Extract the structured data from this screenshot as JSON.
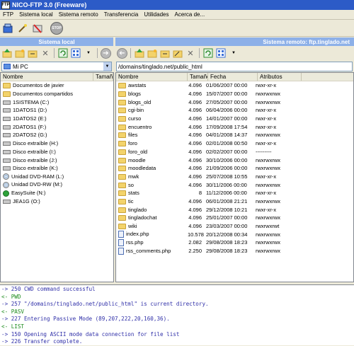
{
  "window": {
    "title": "NICO-FTP 3.0  (Freeware)",
    "app_icon": "ftp-logo-icon"
  },
  "menu": [
    "FTP",
    "Sistema local",
    "Sistema remoto",
    "Transferencia",
    "Utilidades",
    "Acerca de..."
  ],
  "main_toolbar": {
    "stop_label": "STOP"
  },
  "local": {
    "header": "Sistema local",
    "path": "Mi PC",
    "columns": {
      "name": "Nombre",
      "size": "Tamañ"
    },
    "items": [
      {
        "name": "Documentos de javier",
        "icon": "folder"
      },
      {
        "name": "Documentos compartidos",
        "icon": "folder"
      },
      {
        "name": "1SISTEMA (C:)",
        "icon": "drive"
      },
      {
        "name": "1DATOS1 (D:)",
        "icon": "drive"
      },
      {
        "name": "1DATOS2 (E:)",
        "icon": "drive"
      },
      {
        "name": "2DATOS1 (F:)",
        "icon": "drive"
      },
      {
        "name": "2DATOS2 (G:)",
        "icon": "drive"
      },
      {
        "name": "Disco extraíble (H:)",
        "icon": "drive"
      },
      {
        "name": "Disco extraíble (I:)",
        "icon": "drive"
      },
      {
        "name": "Disco extraíble (J:)",
        "icon": "drive"
      },
      {
        "name": "Disco extraíble (K:)",
        "icon": "drive"
      },
      {
        "name": "Unidad DVD-RAM (L:)",
        "icon": "cd"
      },
      {
        "name": "Unidad DVD-RW (M:)",
        "icon": "cd"
      },
      {
        "name": "EasySuite (N:)",
        "icon": "app"
      },
      {
        "name": "JEA1G (O:)",
        "icon": "drive"
      }
    ]
  },
  "remote": {
    "header": "Sistema remoto: ftp.tinglado.net",
    "path": "/domains/tinglado.net/public_html",
    "columns": {
      "name": "Nombre",
      "size": "Tamaño",
      "date": "Fecha",
      "attr": "Atributos"
    },
    "items": [
      {
        "name": "awstats",
        "size": "4.096",
        "date": "01/06/2007 00:00",
        "attr": "rwxr-xr-x",
        "icon": "folder"
      },
      {
        "name": "blogs",
        "size": "4.096",
        "date": "15/07/2007 00:00",
        "attr": "rwxrwxrwx",
        "icon": "folder"
      },
      {
        "name": "blogs_old",
        "size": "4.096",
        "date": "27/05/2007 00:00",
        "attr": "rwxrwxrwx",
        "icon": "folder"
      },
      {
        "name": "cgi-bin",
        "size": "4.096",
        "date": "06/04/2006 00:00",
        "attr": "rwxr-xr-x",
        "icon": "folder"
      },
      {
        "name": "curso",
        "size": "4.096",
        "date": "14/01/2007 00:00",
        "attr": "rwxr-xr-x",
        "icon": "folder"
      },
      {
        "name": "encuentro",
        "size": "4.096",
        "date": "17/09/2008 17:54",
        "attr": "rwxr-xr-x",
        "icon": "folder"
      },
      {
        "name": "files",
        "size": "4.096",
        "date": "04/01/2008 14:37",
        "attr": "rwxrwxrwx",
        "icon": "folder"
      },
      {
        "name": "foro",
        "size": "4.096",
        "date": "02/01/2008 00:50",
        "attr": "rwxr-xr-x",
        "icon": "folder"
      },
      {
        "name": "foro_old",
        "size": "4.096",
        "date": "02/02/2007 00:00",
        "attr": "---------",
        "icon": "folder"
      },
      {
        "name": "moodle",
        "size": "4.096",
        "date": "30/10/2006 00:00",
        "attr": "rwxrwxrwx",
        "icon": "folder"
      },
      {
        "name": "moodledata",
        "size": "4.096",
        "date": "21/09/2006 00:00",
        "attr": "rwxrwxrwx",
        "icon": "folder"
      },
      {
        "name": "mwk",
        "size": "4.096",
        "date": "25/07/2008 10:55",
        "attr": "rwxr-xr-x",
        "icon": "folder"
      },
      {
        "name": "so",
        "size": "4.096",
        "date": "30/11/2006 00:00",
        "attr": "rwxrwxrwx",
        "icon": "folder"
      },
      {
        "name": "stats",
        "size": "8",
        "date": "11/12/2006 00:00",
        "attr": "rwxr-xr-x",
        "icon": "folder"
      },
      {
        "name": "tic",
        "size": "4.096",
        "date": "06/01/2008 21:21",
        "attr": "rwxrwxrwx",
        "icon": "folder"
      },
      {
        "name": "tinglado",
        "size": "4.096",
        "date": "29/12/2008 10:21",
        "attr": "rwxr-xr-x",
        "icon": "folder"
      },
      {
        "name": "tingladochat",
        "size": "4.096",
        "date": "25/01/2007 00:00",
        "attr": "rwxrwxrwx",
        "icon": "folder"
      },
      {
        "name": "wiki",
        "size": "4.096",
        "date": "23/03/2007 00:00",
        "attr": "rwxrwxrwt",
        "icon": "folder"
      },
      {
        "name": "index.php",
        "size": "10.578",
        "date": "20/12/2008 00:34",
        "attr": "rwxrwxrwx",
        "icon": "php"
      },
      {
        "name": "rss.php",
        "size": "2.082",
        "date": "29/08/2008 18:23",
        "attr": "rwxrwxrwx",
        "icon": "php"
      },
      {
        "name": "rss_comments.php",
        "size": "2.250",
        "date": "29/08/2008 18:23",
        "attr": "rwxrwxrwx",
        "icon": "php"
      }
    ]
  },
  "log": [
    {
      "text": "-> 250 CWD command successful",
      "color": "#2f2fa8"
    },
    {
      "text": "<- PWD",
      "color": "#1a8a1a"
    },
    {
      "text": "-> 257 \"/domains/tinglado.net/public_html\" is current directory.",
      "color": "#2f2fa8"
    },
    {
      "text": "<- PASV",
      "color": "#1a8a1a"
    },
    {
      "text": "-> 227 Entering Passive Mode (89,207,222,20,160,36).",
      "color": "#2f2fa8"
    },
    {
      "text": "<- LIST",
      "color": "#1a8a1a"
    },
    {
      "text": "-> 150 Opening ASCII mode data connection for file list",
      "color": "#2f2fa8"
    },
    {
      "text": "-> 226 Transfer complete.",
      "color": "#2f2fa8"
    }
  ],
  "colors": {
    "title_bar": "#2c5bc7",
    "panel_header": "#8db0e8",
    "folder": "#f3d36b"
  }
}
